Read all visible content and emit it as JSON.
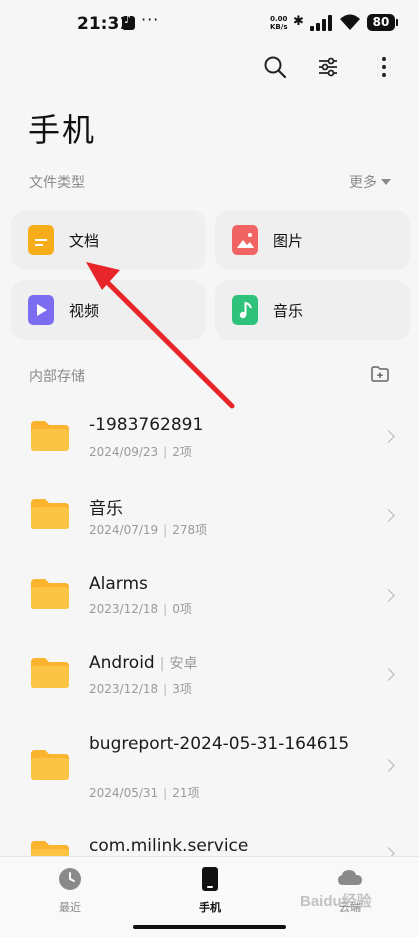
{
  "status_bar": {
    "time": "21:31",
    "more": "···",
    "net_speed_value": "0.00",
    "net_speed_unit": "KB/s",
    "battery": "80"
  },
  "header": {
    "title": "手机",
    "icons": [
      "search-icon",
      "filter-icon",
      "more-vertical-icon"
    ]
  },
  "file_types": {
    "section_label": "文件类型",
    "more_label": "更多",
    "items": [
      {
        "label": "文档",
        "icon": "document-icon",
        "color": "#f7ad19"
      },
      {
        "label": "图片",
        "icon": "image-icon",
        "color": "#f06464"
      },
      {
        "label": "视频",
        "icon": "video-icon",
        "color": "#7b6cf0"
      },
      {
        "label": "音乐",
        "icon": "music-icon",
        "color": "#2fc27a"
      }
    ]
  },
  "storage": {
    "section_label": "内部存储",
    "files": [
      {
        "name": "-1983762891",
        "date": "2024/09/23",
        "count": "2项",
        "tag": ""
      },
      {
        "name": "音乐",
        "date": "2024/07/19",
        "count": "278项",
        "tag": ""
      },
      {
        "name": "Alarms",
        "date": "2023/12/18",
        "count": "0项",
        "tag": ""
      },
      {
        "name": "Android",
        "date": "2023/12/18",
        "count": "3项",
        "tag": "安卓"
      },
      {
        "name": "bugreport-2024-05-31-164615",
        "date": "2024/05/31",
        "count": "21项",
        "tag": ""
      },
      {
        "name": "com.milink.service",
        "date": "",
        "count": "",
        "tag": ""
      }
    ]
  },
  "bottom_nav": {
    "items": [
      {
        "label": "最近",
        "icon": "clock-icon"
      },
      {
        "label": "手机",
        "icon": "phone-icon"
      },
      {
        "label": "云端",
        "icon": "cloud-icon"
      }
    ]
  },
  "watermark": "Baidu经验",
  "colors": {
    "folder": "#fbb42e",
    "annotation_arrow": "#e8262a",
    "accent_text": "#111111"
  }
}
